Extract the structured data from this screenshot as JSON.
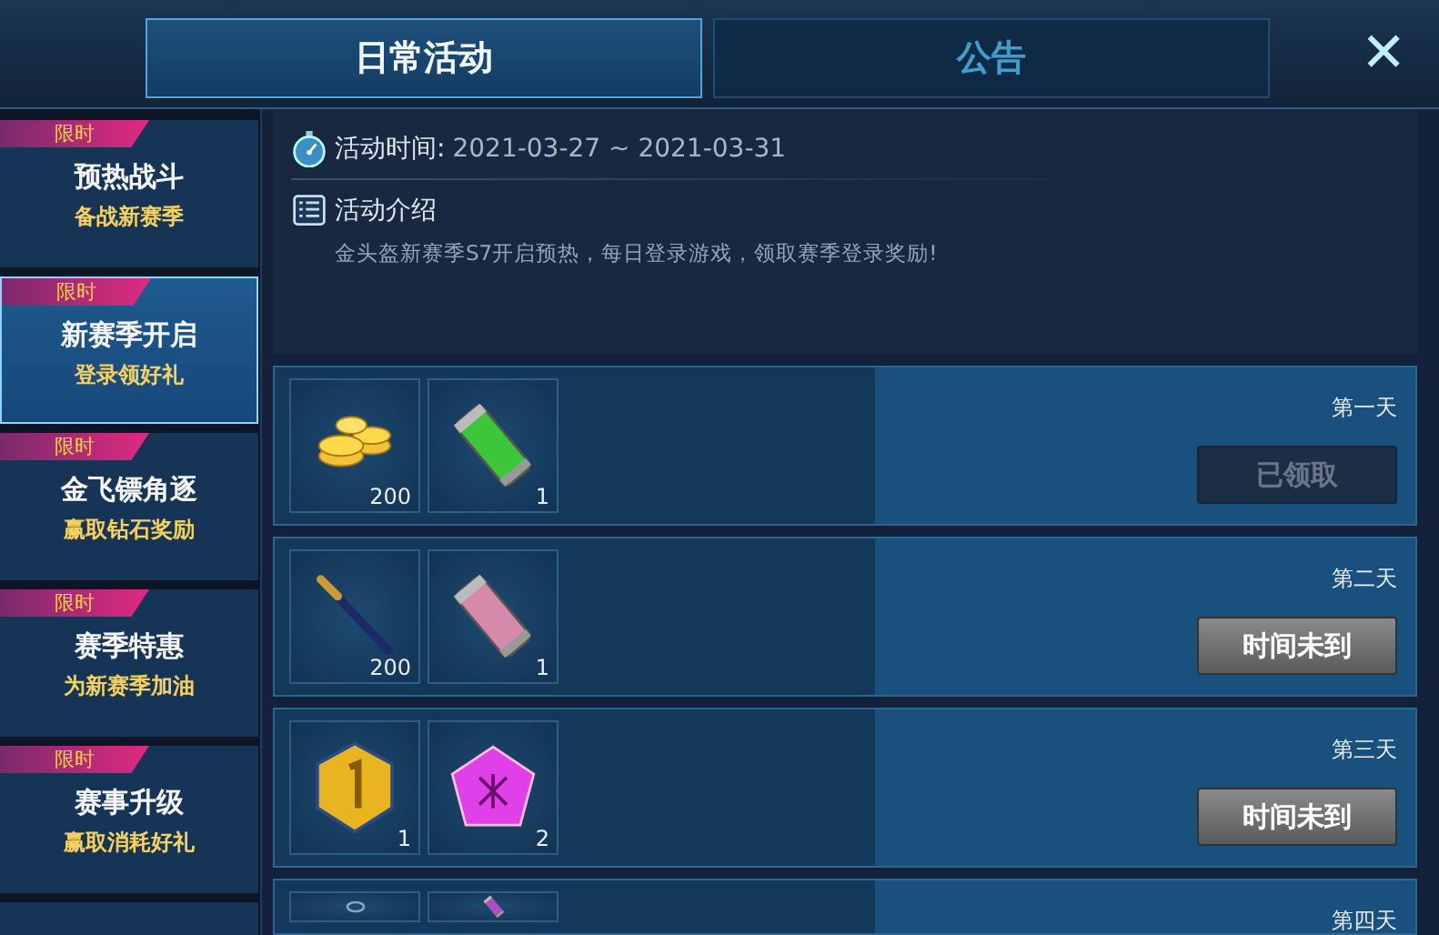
{
  "tabs": [
    {
      "label": "日常活动",
      "selected": true
    },
    {
      "label": "公告",
      "selected": false
    }
  ],
  "close": {
    "label": "✕"
  },
  "sidebar": {
    "items": [
      {
        "tag": "限时",
        "title": "预热战斗",
        "subtitle": "备战新赛季",
        "selected": false
      },
      {
        "tag": "限时",
        "title": "新赛季开启",
        "subtitle": "登录领好礼",
        "selected": true
      },
      {
        "tag": "限时",
        "title": "金飞镖角逐",
        "subtitle": "赢取钻石奖励",
        "selected": false
      },
      {
        "tag": "限时",
        "title": "赛季特惠",
        "subtitle": "为新赛季加油",
        "selected": false
      },
      {
        "tag": "限时",
        "title": "赛事升级",
        "subtitle": "赢取消耗好礼",
        "selected": false
      }
    ]
  },
  "info": {
    "time_label": "活动时间:",
    "time_value": "2021-03-27 ~ 2021-03-31",
    "intro_title": "活动介绍",
    "intro_text": "金头盔新赛季S7开启预热，每日登录游戏，领取赛季登录奖励!"
  },
  "rewards": [
    {
      "day": "第一天",
      "button": "已领取",
      "claimed": true,
      "items": [
        {
          "kind": "coins",
          "count": "200"
        },
        {
          "kind": "canister",
          "color": "#3cc63a",
          "count": "1"
        }
      ]
    },
    {
      "day": "第二天",
      "button": "时间未到",
      "claimed": false,
      "items": [
        {
          "kind": "pen",
          "count": "200"
        },
        {
          "kind": "canister",
          "color": "#d68aaa",
          "count": "1"
        }
      ]
    },
    {
      "day": "第三天",
      "button": "时间未到",
      "claimed": false,
      "items": [
        {
          "kind": "medal",
          "count": "1"
        },
        {
          "kind": "gem",
          "count": "2"
        }
      ]
    },
    {
      "day": "第四天",
      "items": [
        {
          "kind": "ring"
        },
        {
          "kind": "canister",
          "color": "#b04ec0"
        }
      ]
    }
  ]
}
